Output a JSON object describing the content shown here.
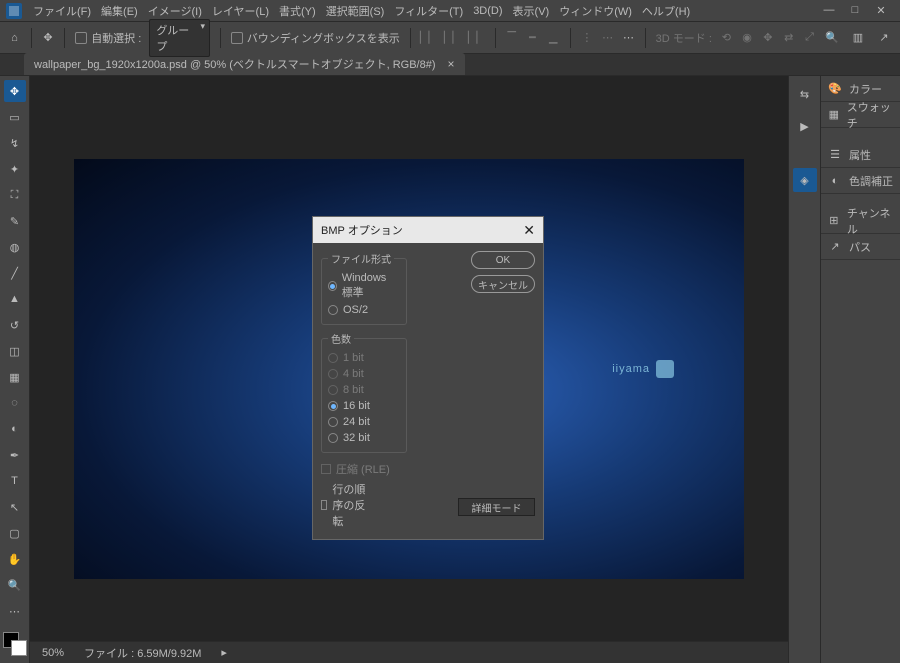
{
  "menubar": {
    "items": [
      "ファイル(F)",
      "編集(E)",
      "イメージ(I)",
      "レイヤー(L)",
      "書式(Y)",
      "選択範囲(S)",
      "フィルター(T)",
      "3D(D)",
      "表示(V)",
      "ウィンドウ(W)",
      "ヘルプ(H)"
    ]
  },
  "optbar": {
    "auto_select": "自動選択 :",
    "dropdown": "グループ",
    "bounding": "バウンディングボックスを表示",
    "mode3d": "3D モード :"
  },
  "tab": {
    "label": "wallpaper_bg_1920x1200a.psd @ 50% (ベクトルスマートオブジェクト, RGB/8#)"
  },
  "canvas_logo": "iiyama",
  "status": {
    "zoom": "50%",
    "doc": "ファイル : 6.59M/9.92M"
  },
  "right_panels": [
    "カラー",
    "スウォッチ",
    "属性",
    "色調補正",
    "チャンネル",
    "パス"
  ],
  "dialog": {
    "title": "BMP オプション",
    "ok": "OK",
    "cancel": "キャンセル",
    "format_legend": "ファイル形式",
    "format_options": [
      "Windows 標準",
      "OS/2"
    ],
    "depth_legend": "色数",
    "depth_options": [
      "1 bit",
      "4 bit",
      "8 bit",
      "16 bit",
      "24 bit",
      "32 bit"
    ],
    "depth_selected": 3,
    "compress": "圧縮 (RLE)",
    "flip": "行の順序の反転",
    "advanced": "詳細モード"
  }
}
